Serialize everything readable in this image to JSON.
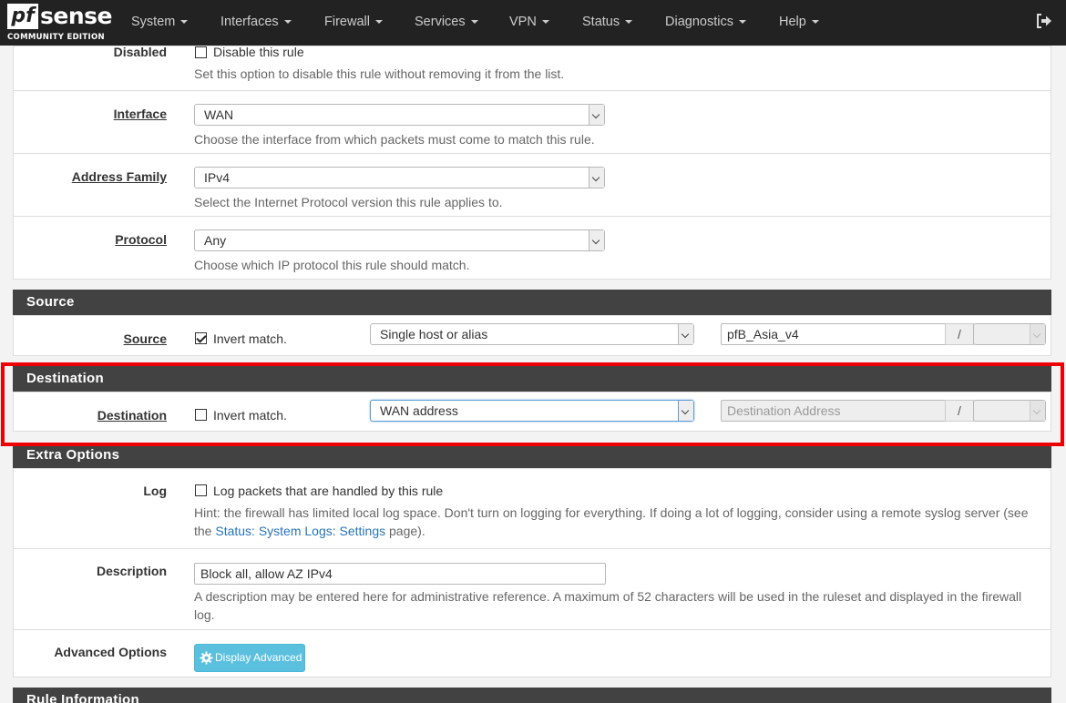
{
  "brand": {
    "pf": "pf",
    "sense": "sense",
    "edition": "COMMUNITY EDITION"
  },
  "nav": {
    "items": [
      "System",
      "Interfaces",
      "Firewall",
      "Services",
      "VPN",
      "Status",
      "Diagnostics",
      "Help"
    ],
    "logout_icon": "sign-out-icon"
  },
  "rule": {
    "disabled": {
      "label": "Disabled",
      "checkbox_label": "Disable this rule",
      "checked": false,
      "help": "Set this option to disable this rule without removing it from the list."
    },
    "interface": {
      "label": "Interface",
      "value": "WAN",
      "help": "Choose the interface from which packets must come to match this rule."
    },
    "address_family": {
      "label": "Address Family",
      "value": "IPv4",
      "help": "Select the Internet Protocol version this rule applies to."
    },
    "protocol": {
      "label": "Protocol",
      "value": "Any",
      "help": "Choose which IP protocol this rule should match."
    }
  },
  "source": {
    "heading": "Source",
    "label": "Source",
    "invert_label": "Invert match.",
    "invert_checked": true,
    "type": "Single host or alias",
    "address": "pfB_Asia_v4",
    "slash": "/"
  },
  "destination": {
    "heading": "Destination",
    "label": "Destination",
    "invert_label": "Invert match.",
    "invert_checked": false,
    "type": "WAN address",
    "address_placeholder": "Destination Address",
    "slash": "/"
  },
  "extra": {
    "heading": "Extra Options",
    "log": {
      "label": "Log",
      "checkbox_label": "Log packets that are handled by this rule",
      "checked": false,
      "help_prefix": "Hint: the firewall has limited local log space. Don't turn on logging for everything. If doing a lot of logging, consider using a remote syslog server (see the ",
      "help_link": "Status: System Logs: Settings",
      "help_suffix": " page)."
    },
    "description": {
      "label": "Description",
      "value": "Block all, allow AZ IPv4",
      "help": "A description may be entered here for administrative reference. A maximum of 52 characters will be used in the ruleset and displayed in the firewall log."
    },
    "advanced": {
      "label": "Advanced Options",
      "button": "Display Advanced",
      "icon": "gear-icon"
    }
  },
  "next_heading": "Rule Information",
  "colors": {
    "navbar": "#222222",
    "panel_heading": "#424242",
    "highlight": "#ee0000",
    "button_info": "#5bc0de",
    "link": "#2a74b8"
  }
}
